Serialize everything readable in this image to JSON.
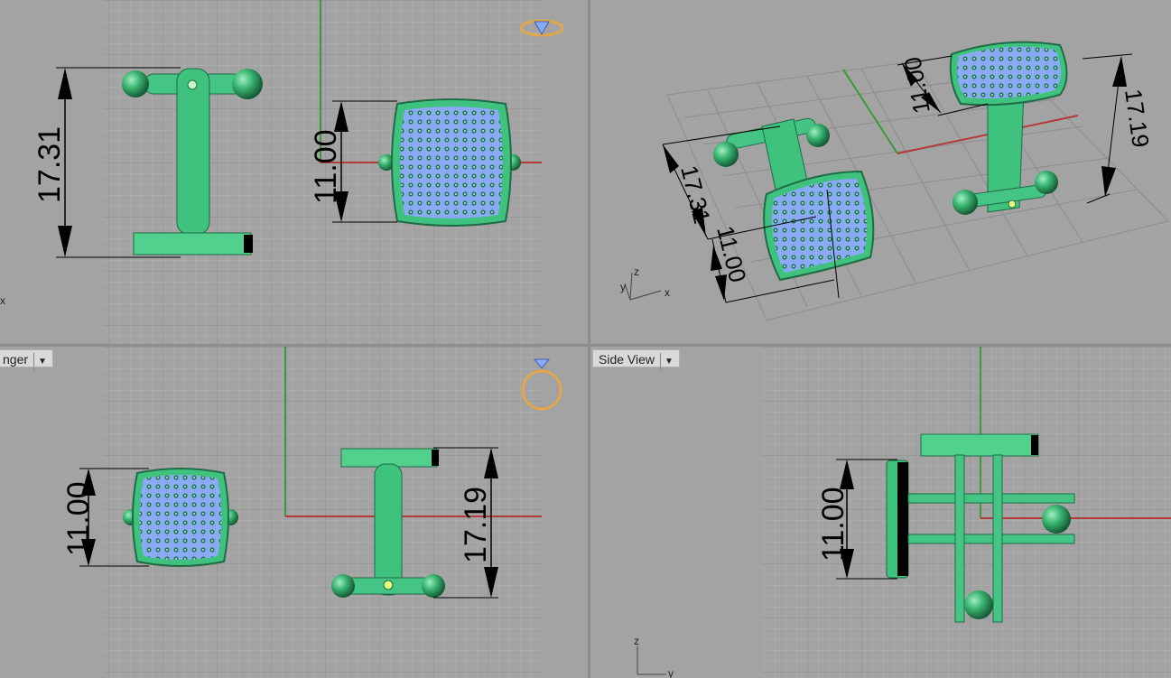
{
  "viewports": {
    "top_left": {
      "label": "",
      "dimensions": [
        "17.31",
        "11.00"
      ],
      "axis": [
        "x"
      ]
    },
    "top_right": {
      "label": "",
      "dimensions": [
        "11.00",
        "17.19",
        "17.31",
        "11.00"
      ],
      "axis": [
        "z",
        "y",
        "x"
      ]
    },
    "bottom_left": {
      "label": "nger",
      "dimensions": [
        "11.00",
        "17.19"
      ]
    },
    "bottom_right": {
      "label": "Side View",
      "dimensions": [
        "11.00"
      ],
      "axis": [
        "z",
        "y"
      ]
    }
  },
  "colors": {
    "background": "#a3a3a3",
    "grid_minor": "#b4b4b4",
    "grid_major": "#8c8c8c",
    "axis_x": "#b23a3a",
    "axis_y": "#3a9a3a",
    "metal": "#3ec27e",
    "metal_dark": "#1f6b45",
    "stone": "#8aaaf5",
    "bead": "#1f7a4a",
    "ring_icon": "#e0a84a"
  },
  "icons": [
    "ring-diamond-icon",
    "ring-icon",
    "dropdown-arrow-icon"
  ]
}
